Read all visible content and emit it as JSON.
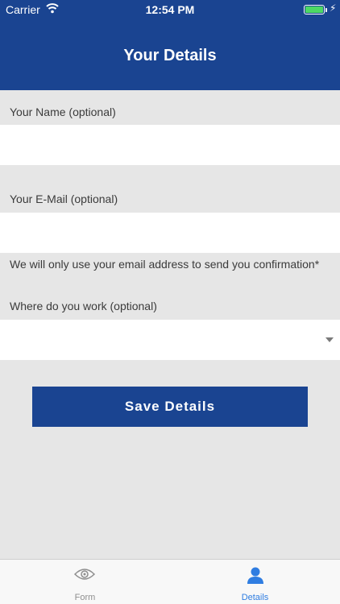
{
  "status_bar": {
    "carrier": "Carrier",
    "time": "12:54 PM",
    "charging_glyph": "⚡"
  },
  "header": {
    "title": "Your Details",
    "background_color": "#1a4491"
  },
  "form": {
    "name_label": "Your Name (optional)",
    "name_value": "",
    "email_label": "Your E-Mail (optional)",
    "email_value": "",
    "email_note": "We will only use your email address to send you confirmation*",
    "work_label": "Where do you work (optional)",
    "work_selected": ""
  },
  "actions": {
    "save_label": "Save Details"
  },
  "tab_bar": {
    "tabs": [
      {
        "label": "Form",
        "icon": "eye-icon",
        "active": false,
        "color": "#8e8e8e"
      },
      {
        "label": "Details",
        "icon": "person-icon",
        "active": true,
        "color": "#2f7de1"
      }
    ]
  }
}
